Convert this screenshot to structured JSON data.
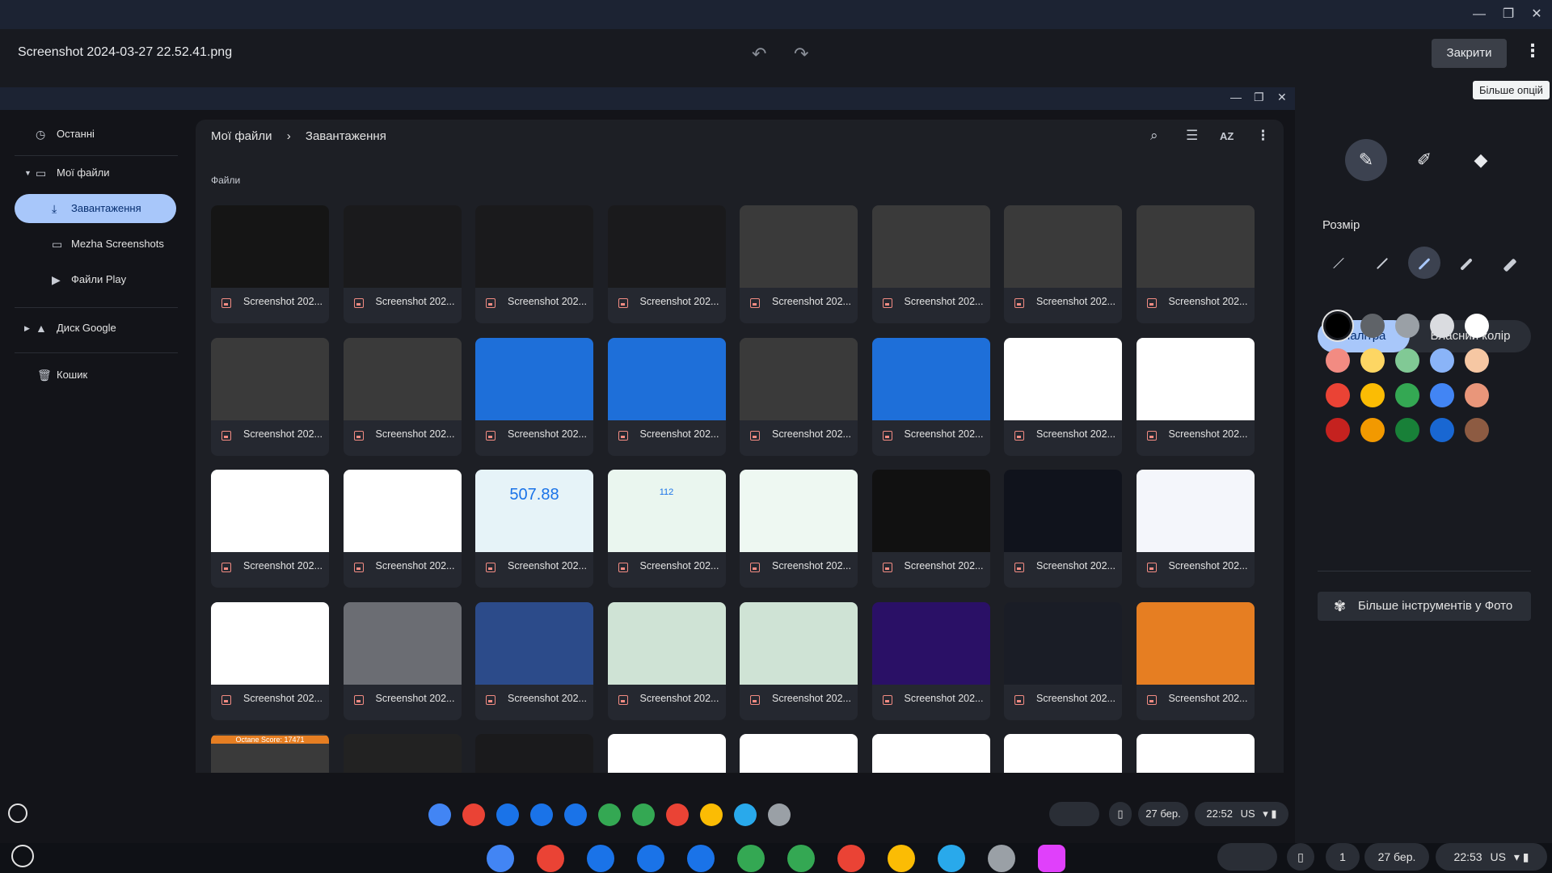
{
  "window": {
    "title": "Screenshot 2024-03-27 22.52.41.png",
    "close_label": "Закрити",
    "tooltip": "Більше опцій"
  },
  "tools": {
    "size_label": "Розмір",
    "tab_palette": "Палітра",
    "tab_custom": "Власний колір",
    "more_tools": "Більше інструментів у Фото",
    "palette": [
      "#000000",
      "#5f6368",
      "#9aa0a6",
      "#dadce0",
      "#ffffff",
      "#f28b82",
      "#fdd663",
      "#81c995",
      "#8ab4f8",
      "#f6c7a3",
      "#ea4335",
      "#fbbc04",
      "#34a853",
      "#4285f4",
      "#e9967a",
      "#c5221f",
      "#f29900",
      "#188038",
      "#1967d2",
      "#8d5b42"
    ]
  },
  "files": {
    "sidebar": {
      "recent": "Останні",
      "my_files": "Мої файли",
      "downloads": "Завантаження",
      "mezha": "Mezha Screenshots",
      "play_files": "Файли Play",
      "google_drive": "Диск Google",
      "trash": "Кошик"
    },
    "breadcrumb": [
      "Мої файли",
      "Завантаження"
    ],
    "section": "Файли",
    "sort_label": "AZ",
    "tile_caption": "Screenshot 202...",
    "thumb_text_a": "507.88",
    "thumb_text_b": "112",
    "thumb_text_c": "Octane Score: 17471"
  },
  "shelf_inner": {
    "date": "27 бер.",
    "time": "22:52",
    "layout": "US"
  },
  "shelf_outer": {
    "notif": "1",
    "date": "27 бер.",
    "time": "22:53",
    "layout": "US"
  }
}
